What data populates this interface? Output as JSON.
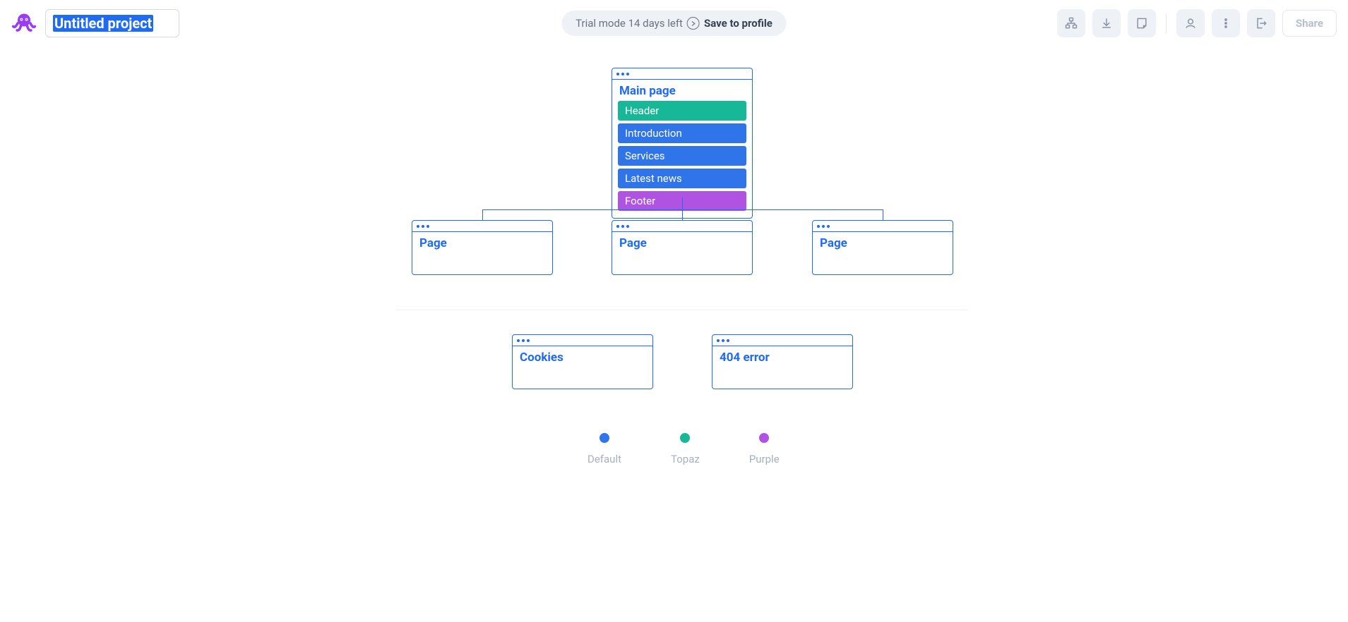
{
  "header": {
    "project_title": "Untitled project",
    "trial_text": "Trial mode 14 days left",
    "save_label": "Save to profile",
    "share_label": "Share"
  },
  "sitemap": {
    "main": {
      "title": "Main page",
      "blocks": [
        {
          "label": "Header",
          "color": "topaz"
        },
        {
          "label": "Introduction",
          "color": "default"
        },
        {
          "label": "Services",
          "color": "default"
        },
        {
          "label": "Latest news",
          "color": "default"
        },
        {
          "label": "Footer",
          "color": "purple"
        }
      ]
    },
    "children": [
      {
        "title": "Page"
      },
      {
        "title": "Page"
      },
      {
        "title": "Page"
      }
    ],
    "extras": [
      {
        "title": "Cookies"
      },
      {
        "title": "404 error"
      }
    ]
  },
  "legend": [
    {
      "label": "Default",
      "color": "#2f74e8"
    },
    {
      "label": "Topaz",
      "color": "#17b897"
    },
    {
      "label": "Purple",
      "color": "#b052e2"
    }
  ],
  "colors": {
    "default": "#2f74e8",
    "topaz": "#17b897",
    "purple": "#b052e2"
  }
}
